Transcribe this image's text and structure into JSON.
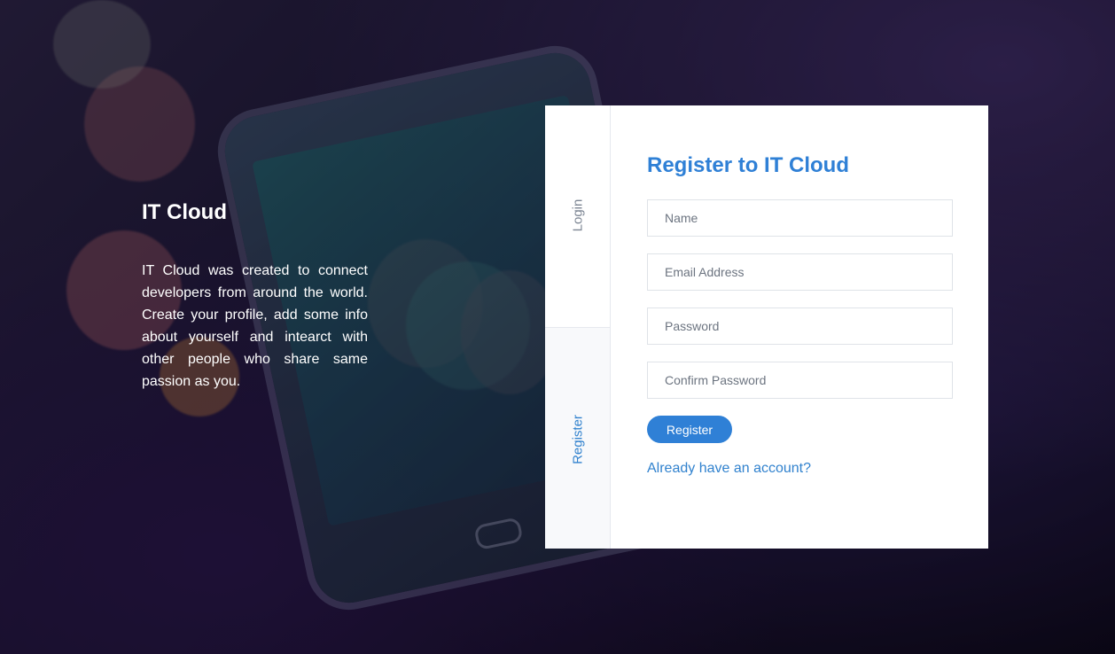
{
  "intro": {
    "title": "IT Cloud",
    "description": "IT Cloud was created to connect developers from around the world. Create your profile, add some info about yourself and intearct with other people who share same passion as you."
  },
  "tabs": {
    "login": "Login",
    "register": "Register"
  },
  "form": {
    "title": "Register to IT Cloud",
    "fields": {
      "name_placeholder": "Name",
      "email_placeholder": "Email Address",
      "password_placeholder": "Password",
      "confirm_password_placeholder": "Confirm Password"
    },
    "submit_label": "Register",
    "account_link": "Already have an account?"
  },
  "colors": {
    "accent": "#2f80d6",
    "card_background": "#ffffff",
    "intro_text": "#ffffff"
  }
}
